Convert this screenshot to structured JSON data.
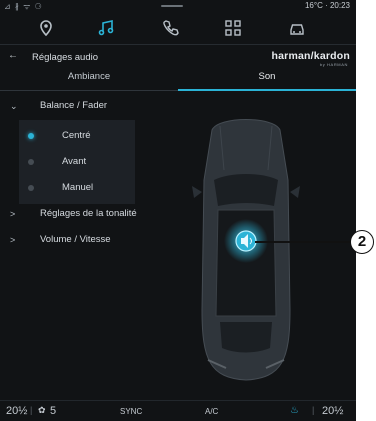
{
  "status_bar": {
    "left": "⊿ ∦ ᯤ ⚆",
    "right": "16°C · 20:23"
  },
  "nav": {
    "icons": [
      "location-pin-icon",
      "music-icon",
      "phone-icon",
      "apps-grid-icon",
      "car-icon"
    ],
    "active": "music-icon"
  },
  "header": {
    "back_symbol": "←",
    "title": "Réglages audio",
    "brand": "harman/kardon",
    "brand_sub": "by HARMAN"
  },
  "tabs": [
    {
      "label": "Ambiance",
      "active": false
    },
    {
      "label": "Son",
      "active": true
    }
  ],
  "list": {
    "balance_fader": {
      "chevron": "⌄",
      "label": "Balance / Fader"
    },
    "options": [
      {
        "label": "Centré",
        "selected": true
      },
      {
        "label": "Avant",
        "selected": false
      },
      {
        "label": "Manuel",
        "selected": false
      }
    ],
    "tonalite": {
      "chevron": ">",
      "label": "Réglages de la tonalité"
    },
    "volume": {
      "chevron": ">",
      "label": "Volume / Vitesse"
    }
  },
  "callout": {
    "number": "2"
  },
  "bottom_bar": {
    "temp_left": "20½",
    "sep": "|",
    "fan_icon": "✿",
    "fan_speed": "5",
    "sync": "SYNC",
    "ac": "A/C",
    "seat_heat_icon": "♨",
    "temp_right": "20½"
  },
  "colors": {
    "accent": "#2bb3d6",
    "background": "#111315",
    "panel": "#1d2126",
    "text": "#d6dbe0"
  }
}
